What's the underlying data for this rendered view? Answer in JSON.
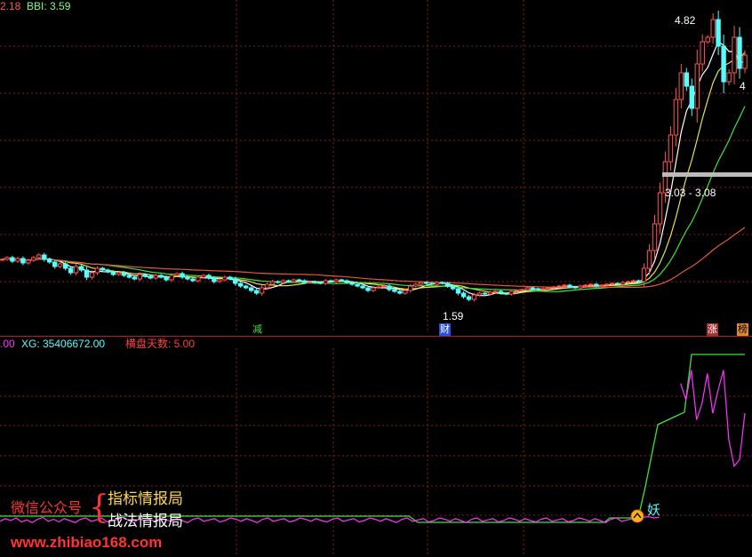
{
  "top_header": {
    "prefix": "2.18",
    "bbi_label": "BBI: 3.59"
  },
  "bottom_header": {
    "prefix": ".00",
    "xg_label": "XG: 35406672.00",
    "hp_label": "横盘天数: 5.00"
  },
  "annotations": {
    "high_price": "4.82",
    "right_price": "4",
    "low_price": "1.59",
    "range_label": "3.03 - 3.08",
    "marker_jian": "减",
    "marker_cai": "财",
    "marker_zhang": "涨",
    "marker_bang": "榜",
    "yao": "妖"
  },
  "watermark": {
    "wechat": "微信公众号",
    "brace": "{",
    "line1": "指标情报局",
    "line2": "战法情报局",
    "url": "www.zhibiao168.com"
  },
  "colors": {
    "up": "#ff5555",
    "down": "#54ffff",
    "ma_white": "#ffffff",
    "ma_yellow": "#e6e64c",
    "ma_green": "#3de33d",
    "ma_red": "#e05a3a",
    "magenta": "#ff33ff",
    "grid": "#8a1a1a"
  },
  "chart_data": [
    {
      "type": "candlestick",
      "title": "",
      "ylim": [
        1.4,
        4.9
      ],
      "x": [
        0,
        1,
        2,
        3,
        4,
        5,
        6,
        7,
        8,
        9,
        10,
        11,
        12,
        13,
        14,
        15,
        16,
        17,
        18,
        19,
        20,
        21,
        22,
        23,
        24,
        25,
        26,
        27,
        28,
        29,
        30,
        31,
        32,
        33,
        34,
        35,
        36,
        37,
        38,
        39,
        40,
        41,
        42,
        43,
        44,
        45,
        46,
        47,
        48,
        49,
        50,
        51,
        52,
        53,
        54,
        55,
        56,
        57,
        58,
        59,
        60,
        61,
        62,
        63,
        64,
        65,
        66,
        67,
        68,
        69,
        70,
        71,
        72,
        73,
        74,
        75,
        76,
        77,
        78,
        79,
        80,
        81,
        82,
        83,
        84,
        85,
        86,
        87,
        88,
        89,
        90,
        91,
        92,
        93,
        94,
        95,
        96,
        97,
        98,
        99,
        100,
        101,
        102,
        103,
        104,
        105,
        106,
        107,
        108,
        109,
        110,
        111,
        112,
        113,
        114,
        115,
        116,
        117,
        118,
        119,
        120,
        121,
        122,
        123,
        124,
        125,
        126,
        127,
        128,
        129,
        130,
        131,
        132,
        133,
        134,
        135,
        136,
        137,
        138,
        139,
        140
      ],
      "close": [
        2.1,
        2.12,
        2.08,
        2.11,
        2.06,
        2.09,
        2.12,
        2.15,
        2.1,
        2.07,
        2.02,
        2.05,
        2.0,
        1.95,
        2.02,
        1.98,
        1.9,
        1.95,
        2.0,
        1.98,
        1.96,
        1.93,
        1.95,
        1.92,
        1.9,
        1.88,
        1.93,
        1.91,
        1.89,
        1.92,
        1.9,
        1.87,
        1.92,
        1.94,
        1.9,
        1.88,
        1.86,
        1.9,
        1.92,
        1.89,
        1.85,
        1.87,
        1.9,
        1.88,
        1.83,
        1.8,
        1.78,
        1.75,
        1.72,
        1.78,
        1.82,
        1.85,
        1.84,
        1.86,
        1.85,
        1.87,
        1.86,
        1.84,
        1.85,
        1.84,
        1.83,
        1.86,
        1.85,
        1.87,
        1.86,
        1.84,
        1.82,
        1.8,
        1.78,
        1.75,
        1.78,
        1.79,
        1.8,
        1.76,
        1.74,
        1.72,
        1.75,
        1.8,
        1.82,
        1.84,
        1.83,
        1.82,
        1.84,
        1.83,
        1.8,
        1.77,
        1.72,
        1.68,
        1.65,
        1.7,
        1.72,
        1.71,
        1.73,
        1.74,
        1.72,
        1.71,
        1.74,
        1.75,
        1.76,
        1.78,
        1.77,
        1.76,
        1.77,
        1.78,
        1.79,
        1.8,
        1.81,
        1.79,
        1.78,
        1.8,
        1.81,
        1.82,
        1.8,
        1.81,
        1.82,
        1.83,
        1.82,
        1.84,
        1.85,
        1.86,
        1.85,
        2.0,
        2.2,
        2.5,
        2.85,
        3.2,
        3.5,
        3.9,
        4.2,
        4.05,
        3.8,
        4.3,
        4.55,
        4.6,
        4.8,
        4.5,
        4.1,
        4.2,
        4.6,
        4.25,
        4.4
      ],
      "annotations": [
        "4.82",
        "1.59",
        "3.03 - 3.08"
      ]
    },
    {
      "type": "line",
      "series": [
        {
          "values": [
            -0.03,
            0.01,
            -0.02,
            0.02,
            -0.04,
            -0.01,
            -0.05,
            0.0,
            0.03,
            -0.03,
            0.0,
            -0.04,
            0.01,
            -0.02,
            -0.05,
            0.0,
            0.02,
            -0.03,
            -0.01,
            0.02,
            -0.04,
            -0.02,
            0.0,
            0.03,
            -0.02,
            -0.05,
            0.01,
            -0.02,
            0.0,
            -0.04,
            0.02,
            -0.01,
            -0.03,
            0.01,
            -0.02,
            -0.05,
            0.0,
            0.02,
            -0.03,
            -0.01,
            0.01,
            -0.04,
            -0.02,
            0.02,
            0.0,
            -0.03,
            0.01,
            -0.02,
            -0.05,
            0.0,
            0.02,
            -0.03,
            -0.01,
            0.01,
            -0.04,
            -0.02,
            0.02,
            0.0,
            -0.03,
            0.01,
            -0.02,
            -0.04,
            0.0,
            0.02,
            -0.03,
            -0.01,
            0.01,
            -0.04,
            -0.02,
            0.02,
            0.0,
            -0.03,
            0.01,
            -0.02,
            -0.05,
            0.0,
            0.02,
            -0.03,
            -0.01,
            0.01,
            -0.04,
            -0.02,
            0.02,
            0.0,
            -0.03,
            0.01,
            -0.02,
            -0.05,
            0.0,
            0.02,
            -0.03,
            -0.01,
            0.01,
            -0.04,
            -0.02,
            0.02,
            0.0,
            -0.03,
            0.01,
            -0.02,
            -0.04,
            0.0,
            0.02,
            -0.03,
            -0.01,
            0.01,
            -0.04,
            -0.02,
            0.02,
            0.0,
            -0.03,
            0.01,
            -0.02,
            -0.05,
            0.0,
            0.02,
            -0.03,
            -0.01,
            0.01,
            0.02,
            0.03,
            0.04,
            0.02,
            0.03,
            null,
            null,
            null,
            2.05,
            1.8,
            2.25,
            1.5,
            1.75,
            2.2,
            1.6,
            1.95,
            2.25,
            1.2,
            0.8,
            0.9,
            1.6
          ]
        },
        {
          "values": [
            0.05,
            0.05,
            0.05,
            0.05,
            0.05,
            0.05,
            0.05,
            0.05,
            0.05,
            0.05,
            0.05,
            0.05,
            0.05,
            0.05,
            0.05,
            0.05,
            0.05,
            0.05,
            0.05,
            0.05,
            0.05,
            0.05,
            0.05,
            0.05,
            0.05,
            0.05,
            0.05,
            0.05,
            0.05,
            0.05,
            0.05,
            0.05,
            0.05,
            0.05,
            0.05,
            0.05,
            0.05,
            0.05,
            0.05,
            0.05,
            0.05,
            0.05,
            0.05,
            0.05,
            0.05,
            0.05,
            0.05,
            0.05,
            0.05,
            0.05,
            0.05,
            0.05,
            0.05,
            0.05,
            0.05,
            0.05,
            0.05,
            0.05,
            0.05,
            0.05,
            0.05,
            0.05,
            0.05,
            0.05,
            0.05,
            0.05,
            0.05,
            0.05,
            0.05,
            0.05,
            0.05,
            0.05,
            0.05,
            0.05,
            0.05,
            0.05,
            0.05,
            0.05,
            0.05,
            0.05,
            0.05,
            0.05,
            0.05,
            0.05,
            0.05,
            0.05,
            0.05,
            0.05,
            0.05,
            0.05,
            0.05,
            0.05,
            0.05,
            0.05,
            0.05,
            0.05,
            0.05,
            0.05,
            0.05,
            0.05,
            0.05,
            0.05,
            0.05,
            0.05,
            0.05,
            0.05,
            0.05,
            0.05,
            0.05,
            0.05,
            0.05,
            0.05,
            0.05,
            0.05,
            0.05,
            0.05,
            0.05,
            0.05,
            0.05,
            0.05,
            0.05,
            0.05,
            0.05,
            0.05,
            0.05,
            0.05,
            0.05,
            0.05,
            0.05,
            0.05,
            0.05,
            0.05,
            0.05,
            0.05,
            0.05,
            0.05,
            0.05,
            0.05,
            0.05,
            0.05,
            0.05
          ]
        }
      ]
    }
  ]
}
